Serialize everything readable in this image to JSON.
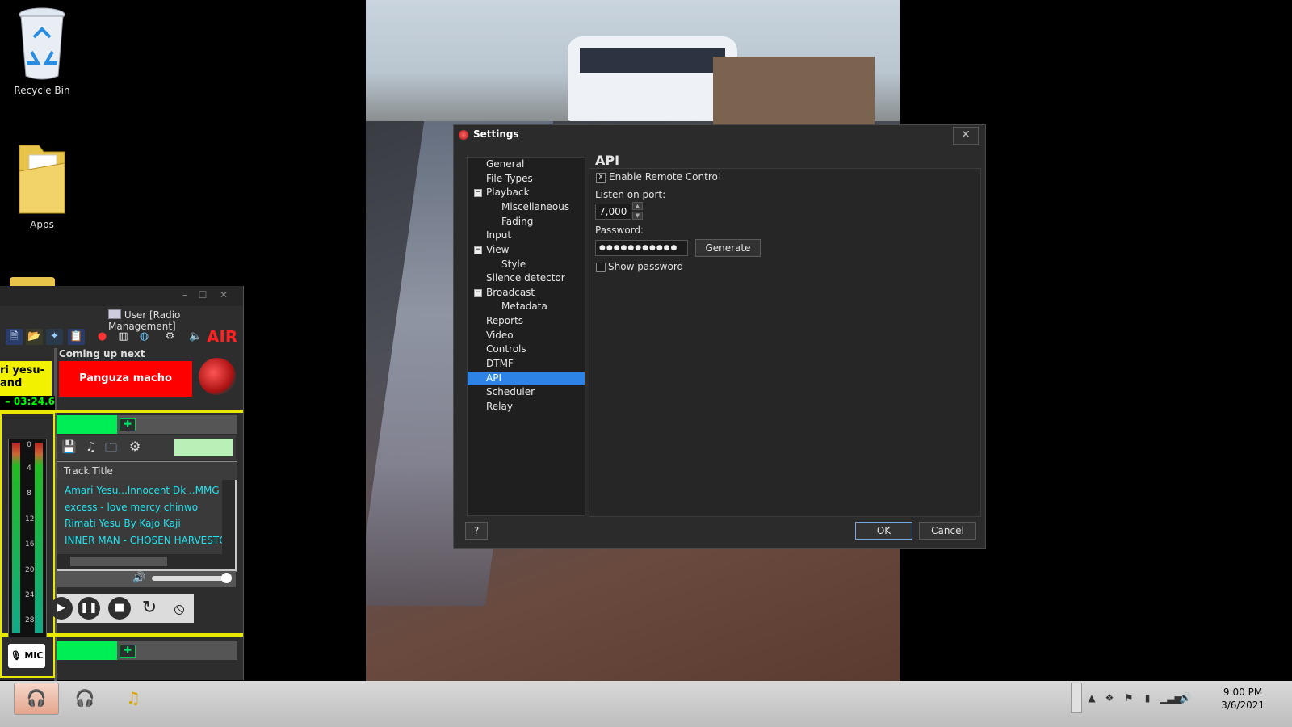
{
  "desktop": {
    "icons": [
      {
        "label": "Recycle Bin"
      },
      {
        "label": "Apps"
      }
    ]
  },
  "settings": {
    "title": "Settings",
    "close_glyph": "✕",
    "tree": [
      {
        "label": "General"
      },
      {
        "label": "File Types"
      },
      {
        "label": "Playback",
        "expander": "−"
      },
      {
        "label": "Miscellaneous"
      },
      {
        "label": "Fading"
      },
      {
        "label": "Input"
      },
      {
        "label": "View",
        "expander": "−"
      },
      {
        "label": "Style"
      },
      {
        "label": "Silence detector"
      },
      {
        "label": "Broadcast",
        "expander": "−"
      },
      {
        "label": "Metadata"
      },
      {
        "label": "Reports"
      },
      {
        "label": "Video"
      },
      {
        "label": "Controls"
      },
      {
        "label": "DTMF"
      },
      {
        "label": "API"
      },
      {
        "label": "Scheduler"
      },
      {
        "label": "Relay"
      }
    ],
    "selected": "API",
    "panel": {
      "title": "API",
      "enable_remote_label": "Enable Remote Control",
      "enable_remote_checked": true,
      "enable_remote_mark": "X",
      "port_label": "Listen on port:",
      "port_value": "7,000",
      "password_label": "Password:",
      "password_value": "●●●●●●●●●●●",
      "generate_label": "Generate",
      "show_password_label": "Show password",
      "show_password_checked": false
    },
    "help_label": "?",
    "ok_label": "OK",
    "cancel_label": "Cancel"
  },
  "radio_app": {
    "user_label": "User [Radio Management]",
    "air_label": "AIR",
    "coming_up_label": "Coming up next",
    "next_track": "Panguza macho",
    "current_track": "ri yesu-\nand",
    "current_time": "– 03:24.6",
    "vu_scale": [
      "0",
      "4",
      "8",
      "12",
      "16",
      "20",
      "24",
      "28"
    ],
    "mic_label": "MIC",
    "playlist_header": "Track Title",
    "tracks": [
      "Amari Yesu...Innocent Dk ..MMG PRO",
      "excess - love mercy chinwo",
      "Rimati Yesu By Kajo Kaji",
      "INNER MAN - CHOSEN HARVESTORS"
    ]
  },
  "taskbar": {
    "time": "9:00 PM",
    "date": "3/6/2021"
  },
  "colors": {
    "selection": "#2d84e6",
    "on_air": "#ff2222",
    "next_box": "#ff0000",
    "current_box": "#f2f200",
    "playlist_text": "#22e3f0",
    "tab_green": "#00ee55"
  }
}
